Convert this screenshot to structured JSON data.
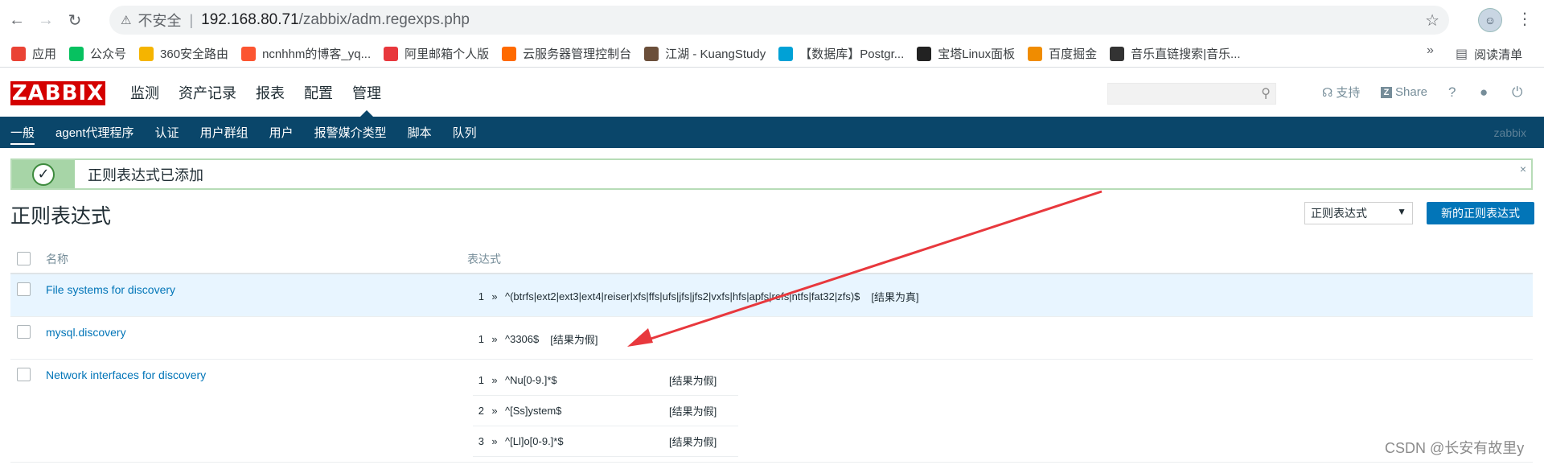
{
  "browser": {
    "insecure_label": "不安全",
    "url_host": "192.168.80.71",
    "url_path": "/zabbix/adm.regexps.php",
    "bookmarks": [
      {
        "label": "应用",
        "icon": "apps-grid-icon",
        "color": "#ea4335"
      },
      {
        "label": "公众号",
        "icon": "wechat-icon",
        "color": "#07c160"
      },
      {
        "label": "360安全路由",
        "icon": "router-360-icon",
        "color": "#f5b400"
      },
      {
        "label": "ncnhhm的博客_yq...",
        "icon": "csdn-c-icon",
        "color": "#fc5531"
      },
      {
        "label": "阿里邮箱个人版",
        "icon": "mail-m-icon",
        "color": "#e8383d"
      },
      {
        "label": "云服务器管理控制台",
        "icon": "aliyun-icon",
        "color": "#ff6a00"
      },
      {
        "label": "江湖 - KuangStudy",
        "icon": "avatar-icon",
        "color": "#6b4f3a"
      },
      {
        "label": "【数据库】Postgr...",
        "icon": "bilibili-icon",
        "color": "#00a1d6"
      },
      {
        "label": "宝塔Linux面板",
        "icon": "bt-icon",
        "color": "#222222"
      },
      {
        "label": "百度掘金",
        "icon": "juejin-icon",
        "color": "#f08c00"
      },
      {
        "label": "音乐直链搜索|音乐...",
        "icon": "music-icon",
        "color": "#333333"
      }
    ],
    "bookmark_more": "»",
    "reading_list": "阅读清单"
  },
  "header": {
    "logo": "ZABBIX",
    "menu": [
      "监测",
      "资产记录",
      "报表",
      "配置",
      "管理"
    ],
    "active_menu_index": 4,
    "support": "支持",
    "share": "Share",
    "help": "?",
    "user_icon": "user-icon",
    "logout_icon": "power-icon"
  },
  "subnav": {
    "items": [
      "一般",
      "agent代理程序",
      "认证",
      "用户群组",
      "用户",
      "报警媒介类型",
      "脚本",
      "队列"
    ],
    "active_index": 0,
    "server_name": "zabbix"
  },
  "message": {
    "text": "正则表达式已添加",
    "close": "×"
  },
  "page": {
    "title": "正则表达式",
    "filter_value": "正则表达式",
    "create_button": "新的正则表达式"
  },
  "table": {
    "headers": {
      "name": "名称",
      "expressions": "表达式"
    },
    "rows": [
      {
        "name": "File systems for discovery",
        "expressions": [
          {
            "num": "1",
            "expr": "^(btrfs|ext2|ext3|ext4|reiser|xfs|ffs|ufs|jfs|jfs2|vxfs|hfs|apfs|refs|ntfs|fat32|zfs)$",
            "result": "[结果为真]"
          }
        ]
      },
      {
        "name": "mysql.discovery",
        "expressions": [
          {
            "num": "1",
            "expr": "^3306$",
            "result": "[结果为假]"
          }
        ]
      },
      {
        "name": "Network interfaces for discovery",
        "expressions": [
          {
            "num": "1",
            "expr": "^Nu[0-9.]*$",
            "result": "[结果为假]"
          },
          {
            "num": "2",
            "expr": "^[Ss]ystem$",
            "result": "[结果为假]"
          },
          {
            "num": "3",
            "expr": "^[Ll]o[0-9.]*$",
            "result": "[结果为假]"
          }
        ]
      }
    ],
    "arrow_symbol": "»"
  },
  "watermark": "CSDN @长安有故里y",
  "colors": {
    "brand_red": "#d40000",
    "nav_blue": "#0a466a",
    "link_blue": "#0275b8",
    "success_green": "#a7d5a7",
    "annotation_red": "#e8383d"
  }
}
